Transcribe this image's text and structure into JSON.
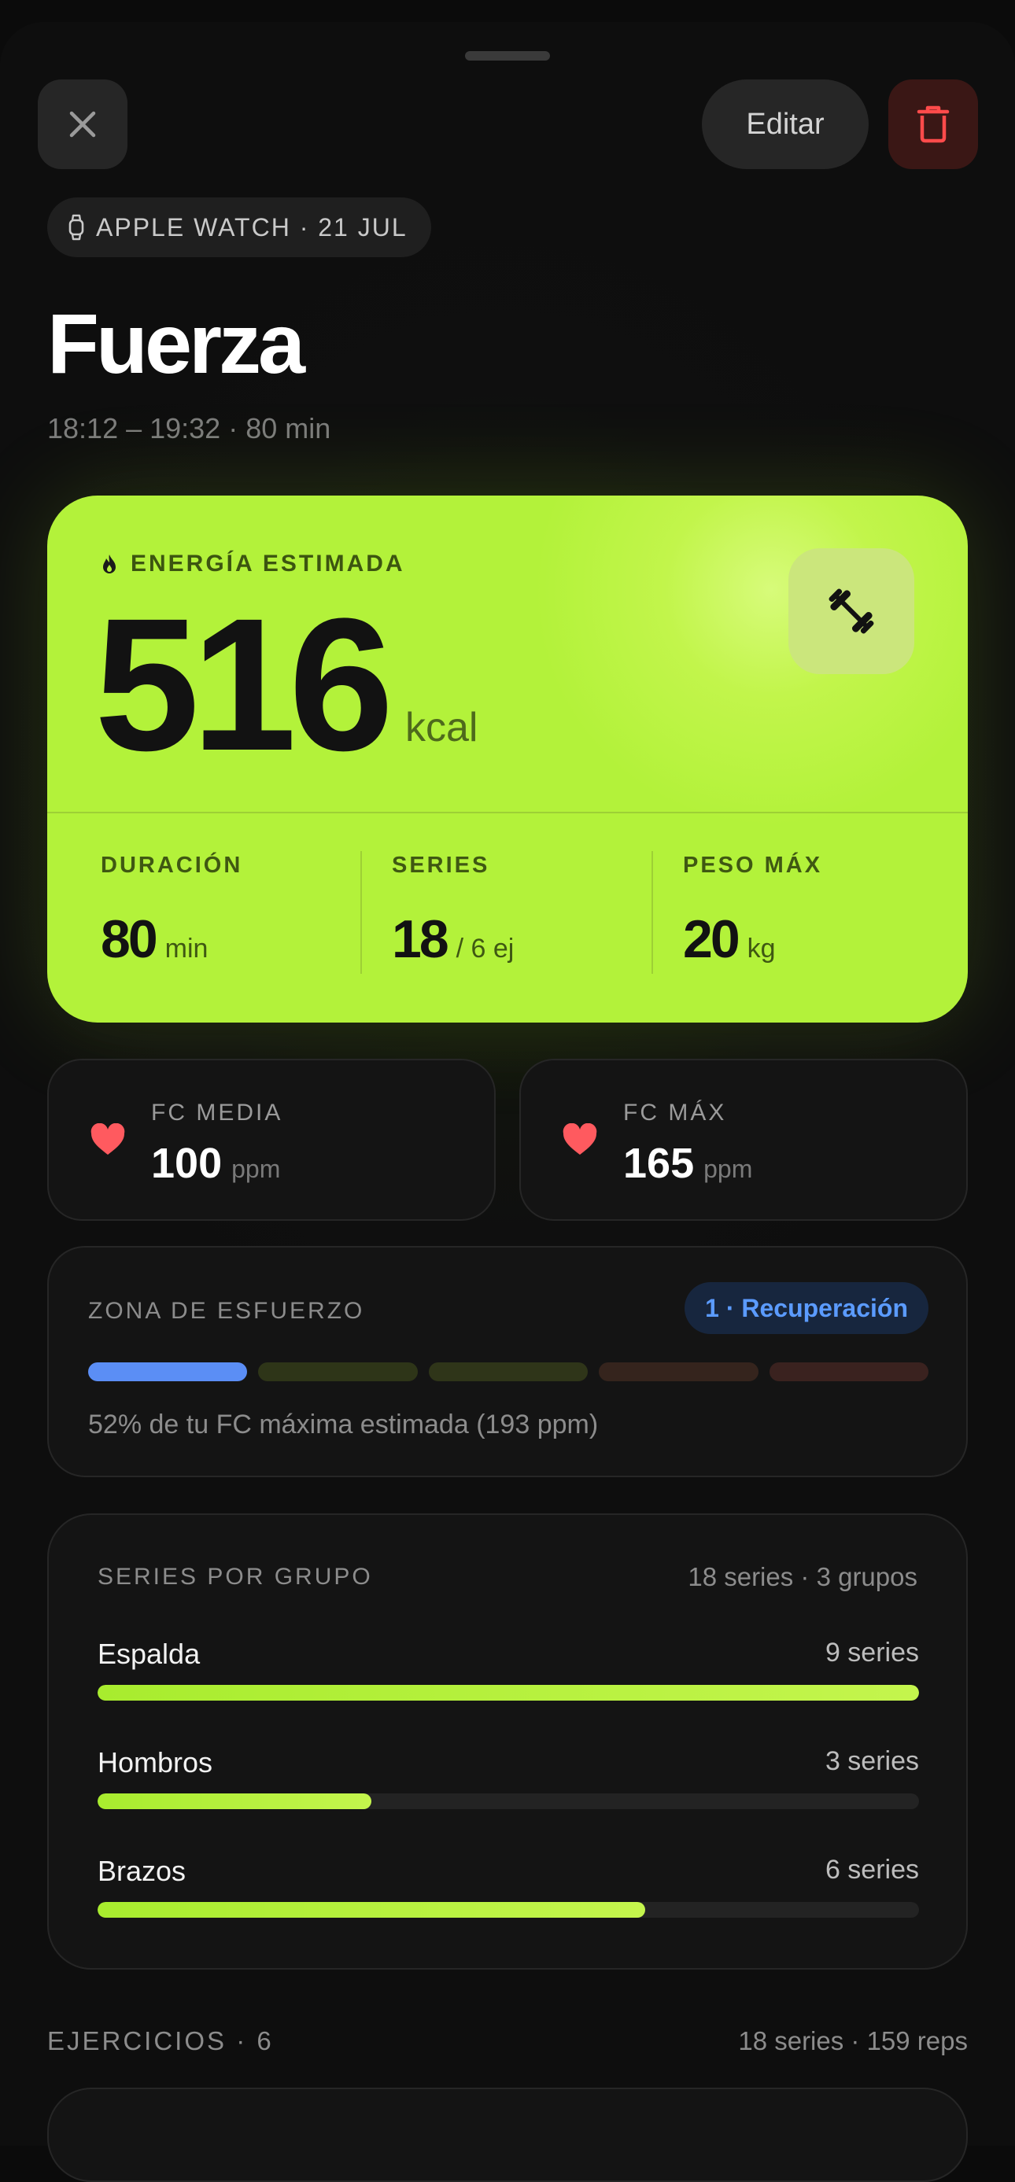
{
  "header": {
    "edit_label": "Editar"
  },
  "source": {
    "text": "APPLE WATCH · 21 JUL"
  },
  "workout": {
    "title": "Fuerza",
    "time_range": "18:12 – 19:32 · 80 min"
  },
  "energy": {
    "label": "ENERGÍA ESTIMADA",
    "value": "516",
    "unit": "kcal",
    "stats": [
      {
        "label": "DURACIÓN",
        "value": "80",
        "unit": "min"
      },
      {
        "label": "SERIES",
        "value": "18",
        "unit": "/ 6 ej"
      },
      {
        "label": "PESO MÁX",
        "value": "20",
        "unit": "kg"
      }
    ]
  },
  "heart_rate": [
    {
      "label": "FC MEDIA",
      "value": "100",
      "unit": "ppm"
    },
    {
      "label": "FC MÁX",
      "value": "165",
      "unit": "ppm"
    }
  ],
  "zone": {
    "label": "ZONA DE ESFUERZO",
    "badge": "1 · Recuperación",
    "description": "52% de tu FC máxima estimada (193 ppm)",
    "active_zone": 1,
    "segment_colors": [
      "#5b8ef5",
      "#2e3518",
      "#2f3519",
      "#35241d",
      "#3a221f"
    ]
  },
  "groups": {
    "label": "SERIES POR GRUPO",
    "summary": "18 series · 3 grupos",
    "items": [
      {
        "name": "Espalda",
        "count": "9 series",
        "fraction": 1.0
      },
      {
        "name": "Hombros",
        "count": "3 series",
        "fraction": 0.333
      },
      {
        "name": "Brazos",
        "count": "6 series",
        "fraction": 0.667
      }
    ]
  },
  "exercises": {
    "label": "EJERCICIOS · 6",
    "summary": "18 series · 159 reps"
  },
  "colors": {
    "accent": "#b7f23c",
    "heart": "#ff5a5f",
    "delete": "#ff4b4b",
    "zone_blue": "#5b9bff"
  }
}
